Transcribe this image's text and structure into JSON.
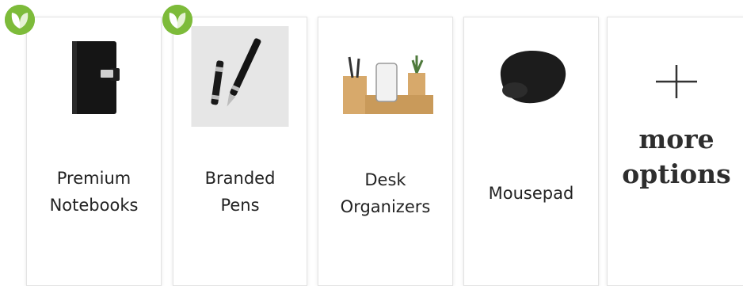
{
  "products": [
    {
      "label": "Premium\nNotebooks",
      "eco_badge": true
    },
    {
      "label": "Branded\nPens",
      "eco_badge": true
    },
    {
      "label": "Desk\nOrganizers",
      "eco_badge": false
    },
    {
      "label": "Mousepad",
      "eco_badge": false
    }
  ],
  "more": {
    "label_line1": "more",
    "label_line2": "options"
  },
  "colors": {
    "eco_badge": "#7dbb3a",
    "card_border": "#e3e3e3",
    "text": "#222222"
  }
}
